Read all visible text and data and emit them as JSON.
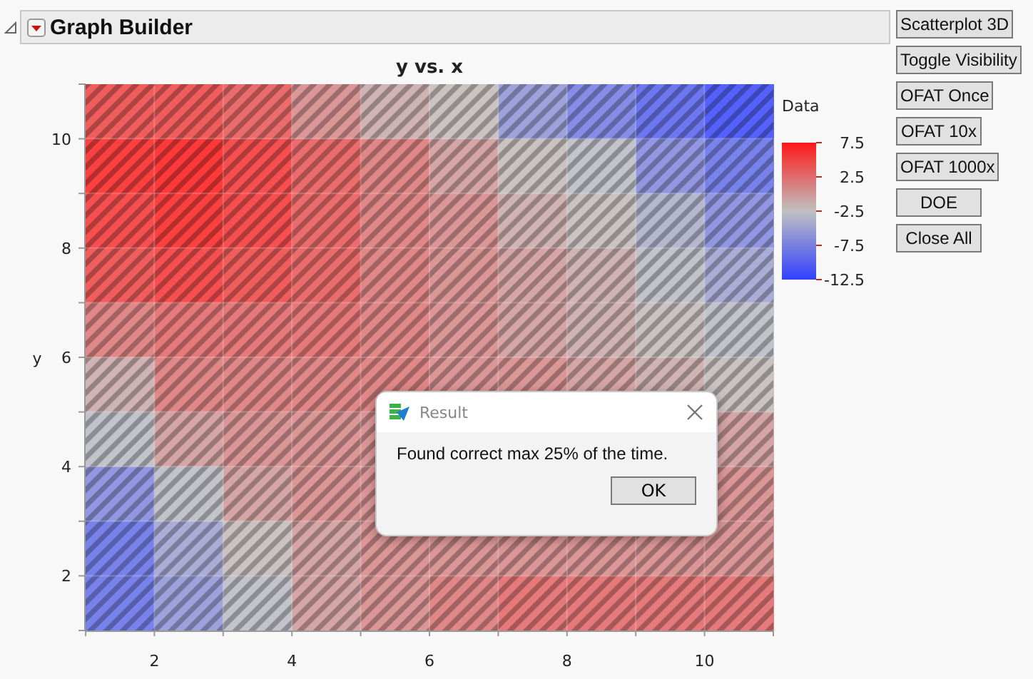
{
  "outline": {
    "title": "Graph Builder",
    "expanded": true
  },
  "graph": {
    "title": "y vs. x",
    "y_axis_label": "y",
    "x_ticks": [
      "2",
      "4",
      "6",
      "8",
      "10"
    ],
    "y_ticks": [
      "10",
      "8",
      "6",
      "4",
      "2"
    ]
  },
  "legend": {
    "title": "Data",
    "labels": [
      "7.5",
      "2.5",
      "-2.5",
      "-7.5",
      "-12.5"
    ]
  },
  "buttons": [
    "Scatterplot 3D",
    "Toggle Visibility",
    "OFAT Once",
    "OFAT 10x",
    "OFAT 1000x",
    "DOE",
    "Close All"
  ],
  "dialog": {
    "title": "Result",
    "message": "Found correct max 25% of the time.",
    "button": "OK"
  }
}
